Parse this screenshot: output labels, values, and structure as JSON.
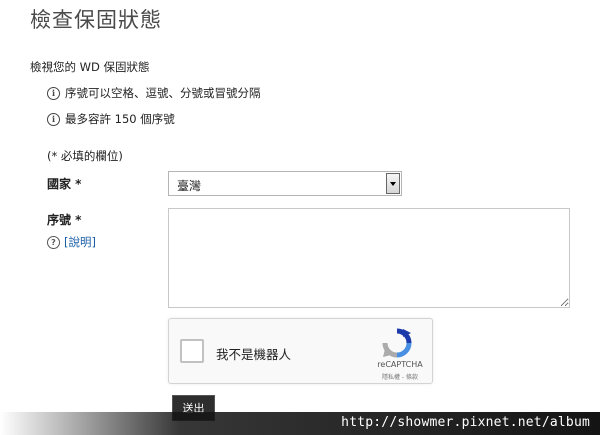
{
  "page": {
    "title": "檢查保固狀態",
    "subtitle": "檢視您的 WD 保固狀態",
    "info": [
      "序號可以空格、逗號、分號或冒號分隔",
      "最多容許 150 個序號"
    ],
    "required_note": "(* 必填的欄位)"
  },
  "form": {
    "country_label": "國家 *",
    "country_value": "臺灣",
    "serial_label": "序號 *",
    "help_text": "[說明]",
    "serial_value": ""
  },
  "captcha": {
    "label": "我不是機器人",
    "brand": "reCAPTCHA",
    "terms": "隱私權 - 條款"
  },
  "submit_label": "送出",
  "watermark": "http://showmer.pixnet.net/album",
  "colors": {
    "link": "#1a5ea8",
    "submit_bg": "#2e2e2e"
  }
}
